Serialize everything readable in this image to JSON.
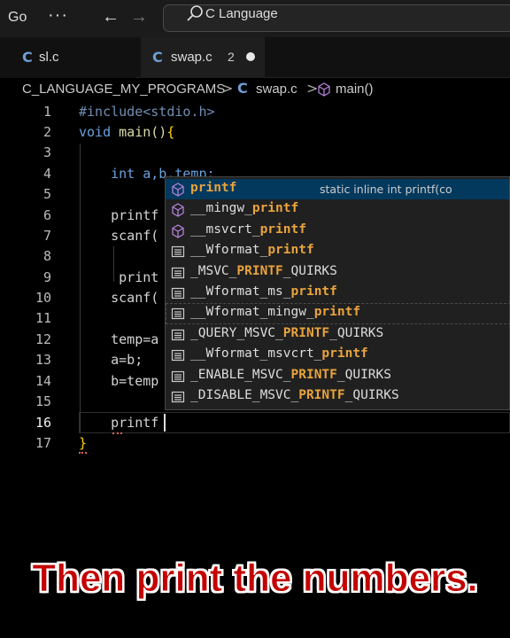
{
  "titlebar": {
    "menu_go": "Go",
    "more": "···",
    "back": "←",
    "forward": "→",
    "search_text": "C Language"
  },
  "tabs": [
    {
      "icon": "C",
      "label": "sl.c"
    },
    {
      "icon": "C",
      "label": "swap.c",
      "badge": "2",
      "dirty": true
    }
  ],
  "breadcrumb": {
    "folder": "C_LANGUAGE_MY_PROGRAMS",
    "sep": ">",
    "file_icon": "C",
    "file": "swap.c",
    "func": "main()"
  },
  "editor": {
    "active_line": 16,
    "line_numbers": [
      "1",
      "2",
      "3",
      "4",
      "5",
      "6",
      "7",
      "8",
      "9",
      "10",
      "11",
      "12",
      "13",
      "14",
      "15",
      "16",
      "17"
    ],
    "lines": {
      "l1": "#include<stdio.h>",
      "l2_kw": "void",
      "l2_fn": " main()",
      "l2_br": "{",
      "l4": "    int a,b,temp;",
      "l6": "    printf",
      "l7": "    scanf(",
      "l9": "     print",
      "l10": "    scanf(",
      "l12": "    temp=a",
      "l13": "    a=b;",
      "l14": "    b=temp",
      "l16": "    printf",
      "l17": "}"
    }
  },
  "suggest": {
    "items": [
      {
        "pre": "",
        "match": "printf",
        "post": "",
        "icon": "cube-icon",
        "detail": "static inline int printf(co"
      },
      {
        "pre": "__mingw_",
        "match": "printf",
        "post": "",
        "icon": "cube-icon"
      },
      {
        "pre": "__msvcrt_",
        "match": "printf",
        "post": "",
        "icon": "cube-icon"
      },
      {
        "pre": "__Wformat_",
        "match": "printf",
        "post": "",
        "icon": "text-icon"
      },
      {
        "pre": "_MSVC_",
        "match": "PRINTF",
        "post": "_QUIRKS",
        "icon": "text-icon"
      },
      {
        "pre": "__Wformat_ms_",
        "match": "printf",
        "post": "",
        "icon": "text-icon"
      },
      {
        "pre": "__Wformat_mingw_",
        "match": "printf",
        "post": "",
        "icon": "text-icon"
      },
      {
        "pre": "_QUERY_MSVC_",
        "match": "PRINTF",
        "post": "_QUIRKS",
        "icon": "text-icon"
      },
      {
        "pre": "__Wformat_msvcrt_",
        "match": "printf",
        "post": "",
        "icon": "text-icon"
      },
      {
        "pre": "_ENABLE_MSVC_",
        "match": "PRINTF",
        "post": "_QUIRKS",
        "icon": "text-icon"
      },
      {
        "pre": "_DISABLE_MSVC_",
        "match": "PRINTF",
        "post": "_QUIRKS",
        "icon": "text-icon"
      }
    ]
  },
  "caption": "Then print the numbers.",
  "colors": {
    "match": "#e8a33d",
    "selection": "#04395e",
    "caption": "#c40000"
  }
}
